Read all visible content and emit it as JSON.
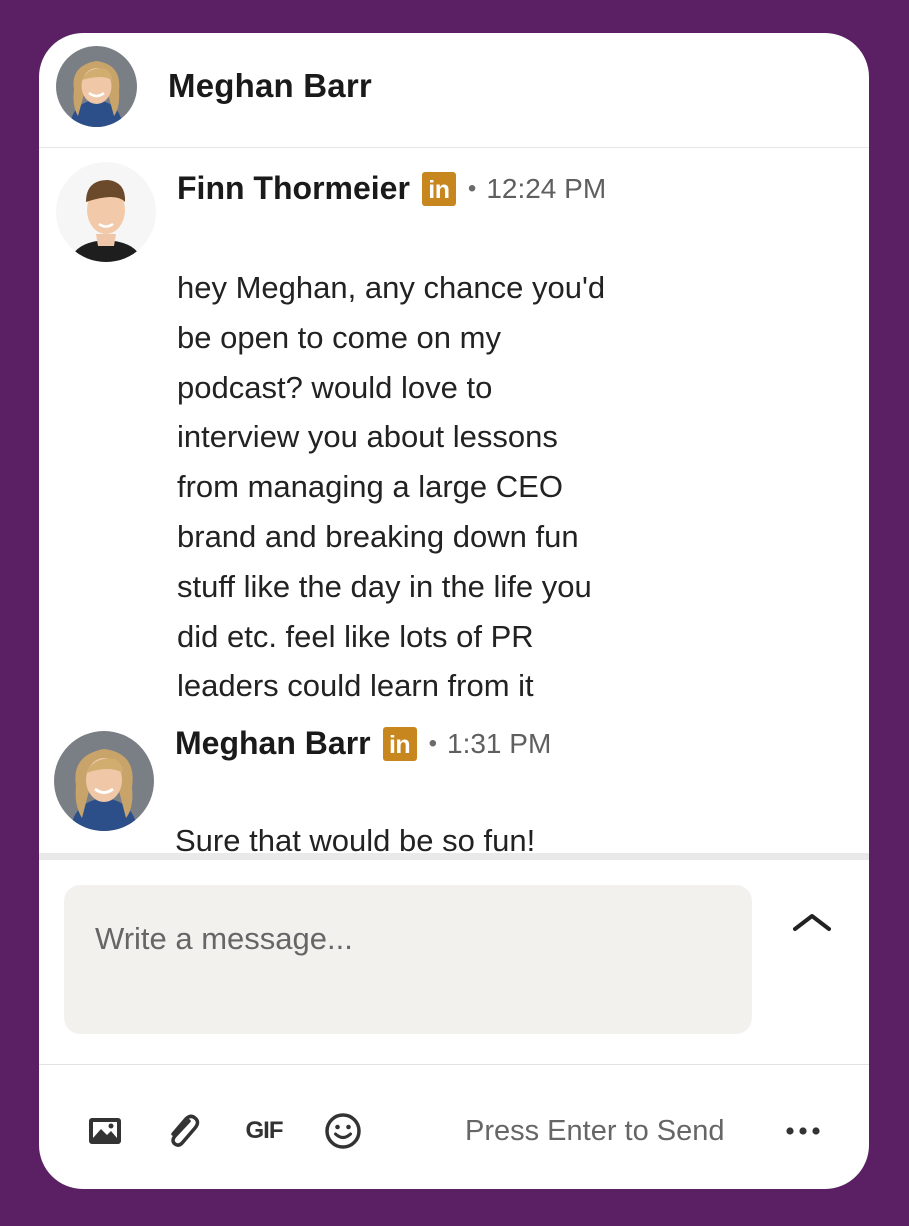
{
  "header": {
    "contact_name": "Meghan Barr"
  },
  "messages": [
    {
      "sender": "Finn Thormeier",
      "badge": "in",
      "separator": "•",
      "time": "12:24 PM",
      "text": "hey Meghan, any chance you'd\nbe open to come on my\npodcast? would love to\ninterview you about lessons\nfrom managing a large CEO\nbrand and breaking down fun\nstuff like the day in the life you\ndid etc. feel like lots of PR\nleaders could learn from it"
    },
    {
      "sender": "Meghan Barr",
      "badge": "in",
      "separator": "•",
      "time": "1:31 PM",
      "text": "Sure that would be so fun!"
    }
  ],
  "composer": {
    "placeholder": "Write a message...",
    "gif_label": "GIF",
    "send_hint": "Press Enter to Send"
  },
  "icons": {
    "image": "image-icon",
    "attach": "paperclip-icon",
    "gif": "gif-icon",
    "emoji": "emoji-icon",
    "more": "more-icon",
    "expand": "chevron-up-icon"
  },
  "colors": {
    "background": "#5b1f63",
    "linkedin_badge": "#c7861e",
    "input_bg": "#f2f1ee"
  }
}
